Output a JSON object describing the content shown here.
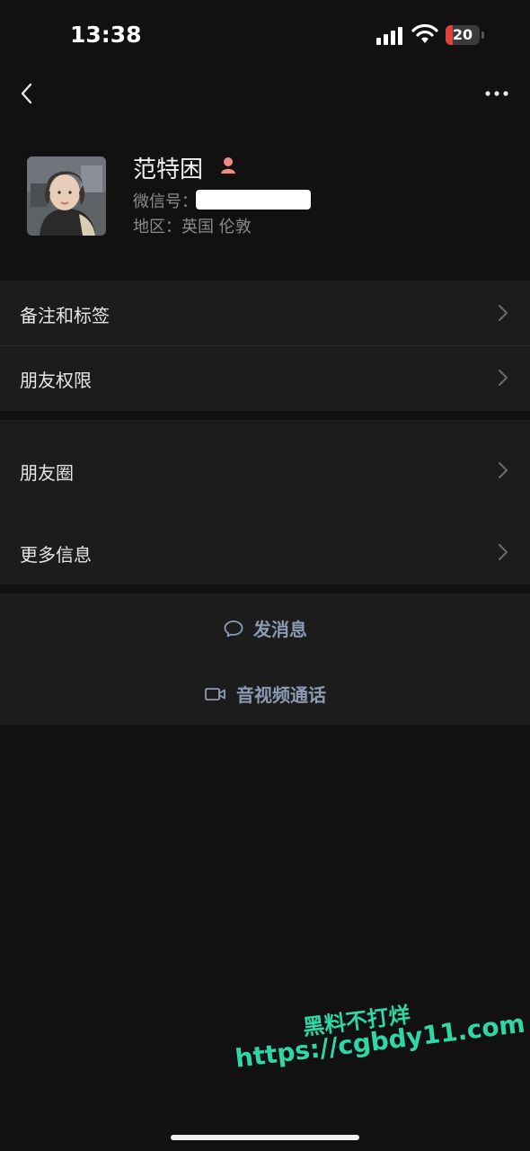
{
  "status_bar": {
    "time": "13:38",
    "battery_level": "20",
    "battery_fraction": 0.2,
    "battery_color": "#e0413a",
    "signal_icon": "cellular-signal-icon",
    "wifi_icon": "wifi-icon"
  },
  "navbar": {
    "back_icon": "chevron-left-icon",
    "more_icon": "more-dots-icon"
  },
  "profile": {
    "name": "范特困",
    "gender_icon": "female-icon",
    "wechat_id_label": "微信号：",
    "region": "地区：英国 伦敦"
  },
  "settings": {
    "items": [
      {
        "label": "备注和标签"
      },
      {
        "label": "朋友权限"
      },
      {
        "label": "朋友圈"
      },
      {
        "label": "更多信息"
      }
    ]
  },
  "actions": {
    "message": "发消息",
    "call": "音视频通话"
  },
  "watermark": {
    "line1": "黑料不打烊",
    "line2": "https://cgbdy11.com"
  },
  "colors": {
    "background": "#111111",
    "cell": "#1c1c1c",
    "action_text": "#8c9ab3",
    "watermark": "#2fd6a6"
  }
}
